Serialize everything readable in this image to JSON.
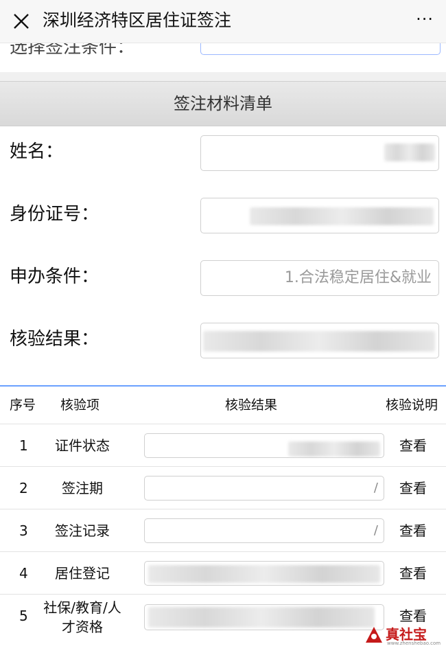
{
  "window": {
    "title": "深圳经济特区居住证签注",
    "close_icon": "close-icon",
    "more_label": "···"
  },
  "top_section": {
    "cut_label": "选择签注条件："
  },
  "section_header": "签注材料清单",
  "form": [
    {
      "label": "姓名：",
      "value": ""
    },
    {
      "label": "身份证号：",
      "value": ""
    },
    {
      "label": "申办条件：",
      "value": "1.合法稳定居住&就业"
    },
    {
      "label": "核验结果：",
      "value": ""
    }
  ],
  "table": {
    "headers": [
      "序号",
      "核验项",
      "核验结果",
      "核验说明"
    ],
    "rows": [
      {
        "index": "1",
        "item": "证件状态",
        "result": "",
        "action": "查看"
      },
      {
        "index": "2",
        "item": "签注期",
        "result": "/",
        "action": "查看"
      },
      {
        "index": "3",
        "item": "签注记录",
        "result": "/",
        "action": "查看"
      },
      {
        "index": "4",
        "item": "居住登记",
        "result": "",
        "action": "查看"
      },
      {
        "index": "5",
        "item": "社保/教育/人才资格",
        "result": "",
        "action": "查看"
      }
    ]
  },
  "watermark": {
    "text": "真社宝",
    "sub": "www.zhenshebao.com"
  },
  "colors": {
    "accent_blue": "#6aa0ff",
    "logo_red": "#c51a1a"
  }
}
